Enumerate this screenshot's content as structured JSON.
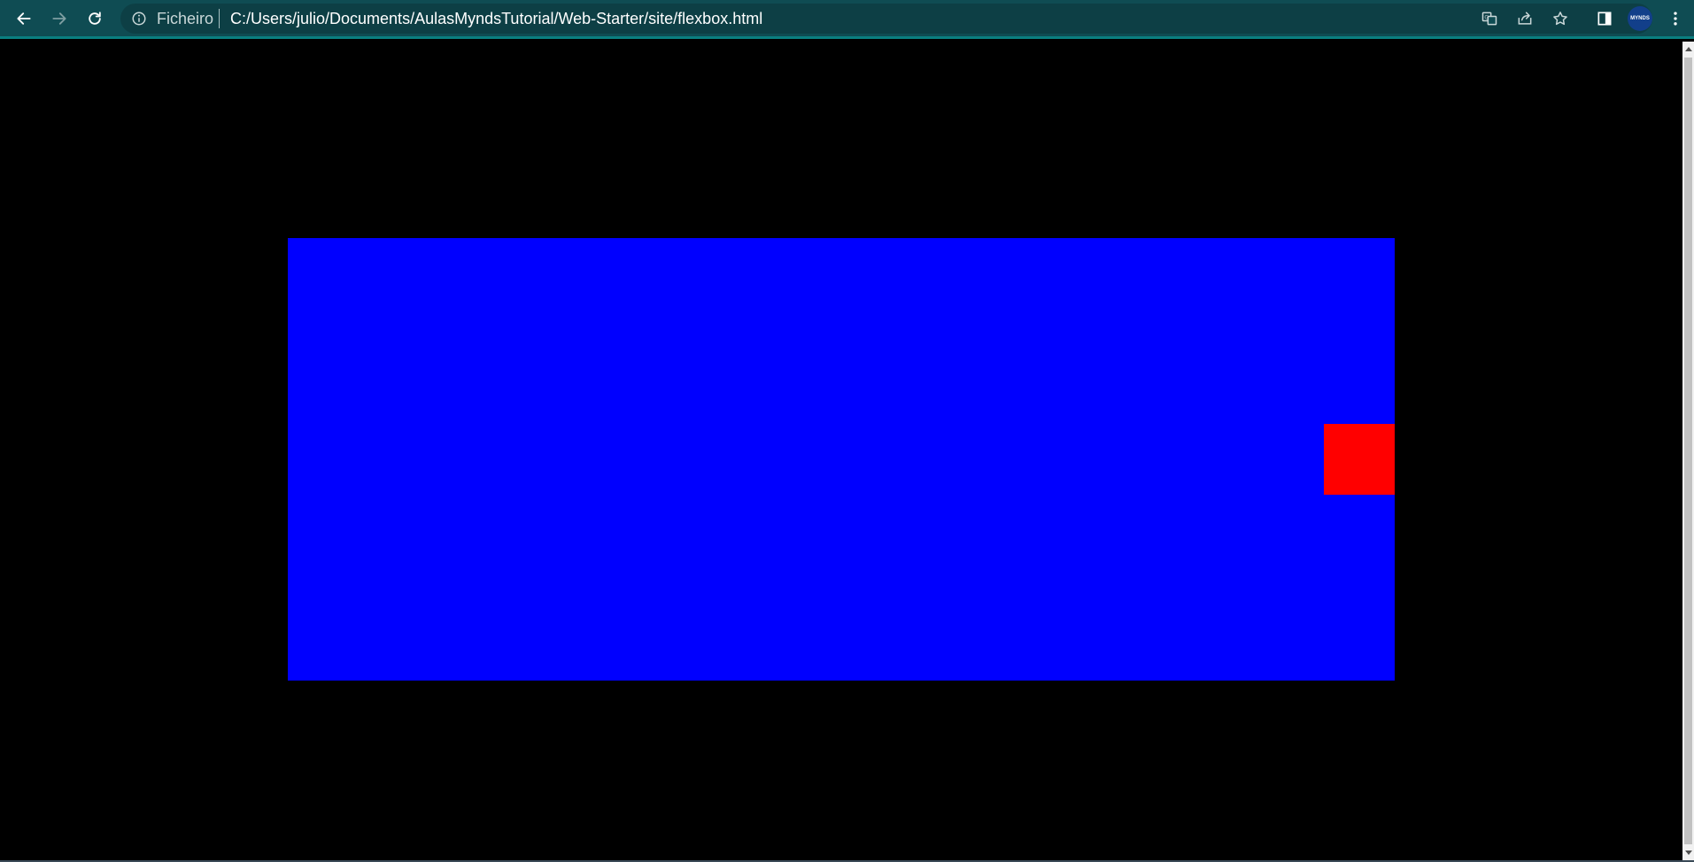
{
  "browser": {
    "back_icon": "arrow-left-icon",
    "forward_icon": "arrow-right-icon",
    "reload_icon": "reload-icon",
    "site_info_icon": "info-icon",
    "scheme_label": "Ficheiro",
    "url": "C:/Users/julio/Documents/AulasMyndsTutorial/Web-Starter/site/flexbox.html",
    "translate_icon": "translate-icon",
    "share_icon": "share-icon",
    "bookmark_icon": "star-icon",
    "side_panel_icon": "side-panel-icon",
    "profile_label": "MYNDS",
    "menu_icon": "kebab-menu-icon",
    "colors": {
      "toolbar": "#0f4c53",
      "omnibox": "#0d3f45",
      "accent": "#0a7f80"
    }
  },
  "page": {
    "background": "#000000",
    "container_color": "#0000ff",
    "item_color": "#ff0000"
  }
}
